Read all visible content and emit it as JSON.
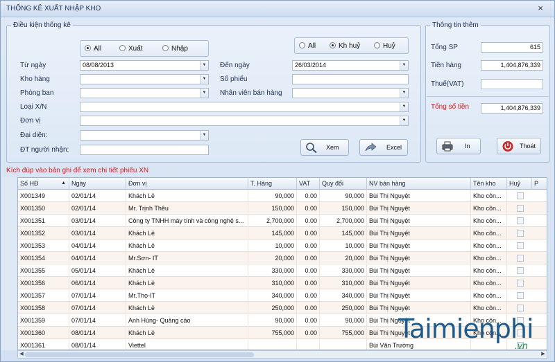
{
  "window": {
    "title": "THỐNG KÊ XUẤT NHẬP KHO",
    "close": "×"
  },
  "conditions": {
    "legend": "Điều kiện thống kê",
    "type_radios": [
      {
        "label": "All",
        "checked": true
      },
      {
        "label": "Xuất",
        "checked": false
      },
      {
        "label": "Nhập",
        "checked": false
      }
    ],
    "cancel_radios": [
      {
        "label": "All",
        "checked": false
      },
      {
        "label": "Kh huỷ",
        "checked": true
      },
      {
        "label": "Huỷ",
        "checked": false
      }
    ],
    "from_date_label": "Từ ngày",
    "from_date_value": "08/08/2013",
    "to_date_label": "Đến ngày",
    "to_date_value": "26/03/2014",
    "warehouse_label": "Kho hàng",
    "warehouse_value": "",
    "voucher_label": "Số phiếu",
    "voucher_value": "",
    "department_label": "Phòng ban",
    "department_value": "",
    "salesperson_label": "Nhân viên bán hàng",
    "salesperson_value": "",
    "xn_type_label": "Loại X/N",
    "xn_type_value": "",
    "unit_label": "Đơn vị",
    "unit_value": "",
    "representative_label": "Đại diện:",
    "representative_value": "",
    "phone_label": "ĐT người nhận:",
    "phone_value": "",
    "view_button": "Xem",
    "excel_button": "Excel"
  },
  "info": {
    "legend": "Thông tin thêm",
    "total_products_label": "Tổng SP",
    "total_products_value": "615",
    "goods_amount_label": "Tiền hàng",
    "goods_amount_value": "1,404,876,339",
    "vat_label": "Thuế(VAT)",
    "vat_value": "",
    "total_amount_label": "Tổng số tiền",
    "total_amount_value": "1,404,876,339",
    "print_button": "In",
    "exit_button": "Thoát"
  },
  "hint": "Kích đúp vào bản ghi để xem chi tiết phiếu XN",
  "table": {
    "columns": [
      "Số HĐ",
      "Ngày",
      "Đơn vị",
      "T. Hàng",
      "VAT",
      "Quy đổi",
      "NV bán hàng",
      "Tên kho",
      "Huỷ",
      "P"
    ],
    "rows": [
      [
        "X001349",
        "02/01/14",
        "Khách Lẻ",
        "90,000",
        "0.00",
        "90,000",
        "Bùi Thị Nguyệt",
        "Kho côn..."
      ],
      [
        "X001350",
        "02/01/14",
        "Mr. Trịnh Thêu",
        "150,000",
        "0.00",
        "150,000",
        "Bùi Thị Nguyệt",
        "Kho côn..."
      ],
      [
        "X001351",
        "03/01/14",
        "Công ty TNHH máy tính và công nghệ s...",
        "2,700,000",
        "0.00",
        "2,700,000",
        "Bùi Thị Nguyệt",
        "Kho côn..."
      ],
      [
        "X001352",
        "03/01/14",
        "Khách Lẻ",
        "145,000",
        "0.00",
        "145,000",
        "Bùi Thị Nguyệt",
        "Kho côn..."
      ],
      [
        "X001353",
        "04/01/14",
        "Khách Lẻ",
        "10,000",
        "0.00",
        "10,000",
        "Bùi Thị Nguyệt",
        "Kho côn..."
      ],
      [
        "X001354",
        "04/01/14",
        "Mr.Sơn- IT",
        "20,000",
        "0.00",
        "20,000",
        "Bùi Thị Nguyệt",
        "Kho côn..."
      ],
      [
        "X001355",
        "05/01/14",
        "Khách Lẻ",
        "330,000",
        "0.00",
        "330,000",
        "Bùi Thị Nguyệt",
        "Kho côn..."
      ],
      [
        "X001356",
        "06/01/14",
        "Khách Lẻ",
        "310,000",
        "0.00",
        "310,000",
        "Bùi Thị Nguyệt",
        "Kho côn..."
      ],
      [
        "X001357",
        "07/01/14",
        "Mr.Thọ-IT",
        "340,000",
        "0.00",
        "340,000",
        "Bùi Thị Nguyệt",
        "Kho côn..."
      ],
      [
        "X001358",
        "07/01/14",
        "Khách Lẻ",
        "250,000",
        "0.00",
        "250,000",
        "Bùi Thị Nguyệt",
        "Kho côn..."
      ],
      [
        "X001359",
        "07/01/14",
        "Anh Hùng- Quảng cáo",
        "90,000",
        "0.00",
        "90,000",
        "Bùi Thị Nguyệt",
        "Kho côn..."
      ],
      [
        "X001360",
        "08/01/14",
        "Khách Lẻ",
        "755,000",
        "0.00",
        "755,000",
        "Bùi Thị Nguyệt",
        "Kho côn..."
      ],
      [
        "X001361",
        "08/01/14",
        "Viettel",
        "",
        "",
        "",
        "Bùi Văn Trường",
        ""
      ]
    ]
  },
  "watermark": {
    "brand": "Taimienphi",
    "tld": ".vn"
  }
}
